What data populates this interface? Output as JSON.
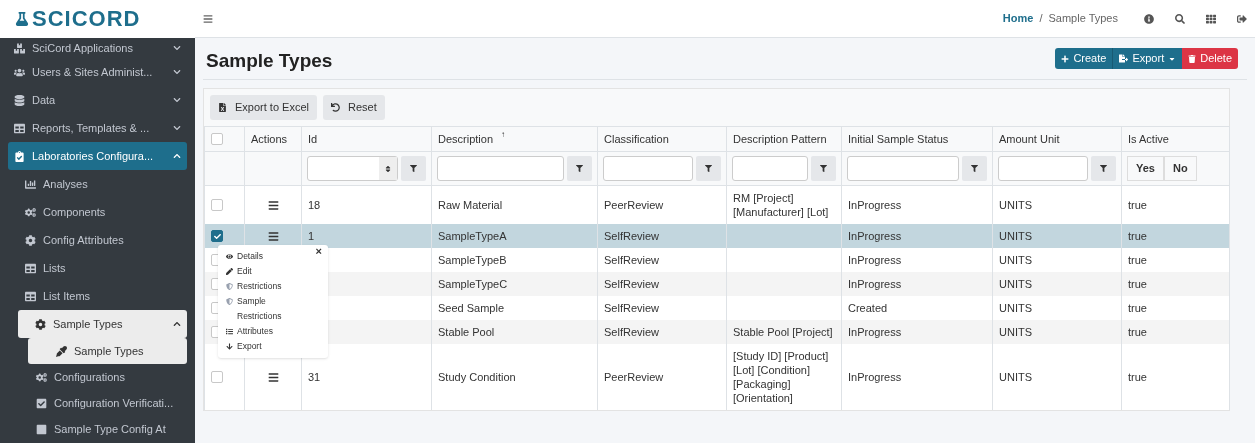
{
  "logo": {
    "text": "SCICORD"
  },
  "header": {
    "breadcrumb": [
      {
        "label": "Home",
        "kind": "link"
      },
      {
        "label": "/",
        "kind": "separator"
      },
      {
        "label": "Sample Types",
        "kind": "current"
      }
    ]
  },
  "sidebar": {
    "items": [
      {
        "label": "SciCord Applications",
        "expanded": false,
        "selected": false
      },
      {
        "label": "Users & Sites Administ...",
        "expanded": false,
        "selected": false
      },
      {
        "label": "Data",
        "expanded": false,
        "selected": false
      },
      {
        "label": "Reports, Templates & ...",
        "expanded": false,
        "selected": false
      },
      {
        "label": "Laboratories Configura...",
        "expanded": true,
        "selected": true,
        "children": [
          {
            "label": "Analyses",
            "selected": false
          },
          {
            "label": "Components",
            "selected": false
          },
          {
            "label": "Config Attributes",
            "selected": false
          },
          {
            "label": "Lists",
            "selected": false
          },
          {
            "label": "List Items",
            "selected": false
          },
          {
            "label": "Sample Types",
            "expanded": true,
            "selected": true,
            "children": [
              {
                "label": "Sample Types",
                "selected": true
              },
              {
                "label": "Configurations",
                "selected": false
              },
              {
                "label": "Configuration Verificati...",
                "selected": false
              },
              {
                "label": "Sample Type Config At",
                "selected": false
              }
            ]
          }
        ]
      }
    ]
  },
  "page": {
    "title": "Sample Types",
    "actions": [
      {
        "label": "Create",
        "kind": "create"
      },
      {
        "label": "Export",
        "kind": "export"
      },
      {
        "label": "Delete",
        "kind": "delete"
      }
    ]
  },
  "toolbar": [
    {
      "label": "Export to Excel",
      "kind": "excel"
    },
    {
      "label": "Reset",
      "kind": "reset"
    }
  ],
  "table": {
    "columns": [
      {
        "kind": "checkbox",
        "checked": false
      },
      {
        "label": "Actions",
        "kind": "none"
      },
      {
        "label": "Id",
        "kind": "number"
      },
      {
        "label": "Description",
        "kind": "text",
        "sort_indicator": "↑"
      },
      {
        "label": "Classification",
        "kind": "text"
      },
      {
        "label": "Description Pattern",
        "kind": "text"
      },
      {
        "label": "Initial Sample Status",
        "kind": "text"
      },
      {
        "label": "Amount Unit",
        "kind": "text"
      },
      {
        "label": "Is Active",
        "kind": "boolean",
        "options": [
          "Yes",
          "No"
        ]
      }
    ],
    "rows": [
      {
        "selected": false,
        "id": "18",
        "description": "Raw Material",
        "classification": "PeerReview",
        "pattern": "RM [Project] [Manufacturer] [Lot]",
        "status": "InProgress",
        "unit": "UNITS",
        "active": "true"
      },
      {
        "selected": true,
        "id": "1",
        "description": "SampleTypeA",
        "classification": "SelfReview",
        "status": "InProgress",
        "unit": "UNITS",
        "active": "true"
      },
      {
        "selected": false,
        "description": "SampleTypeB",
        "classification": "SelfReview",
        "status": "InProgress",
        "unit": "UNITS",
        "active": "true"
      },
      {
        "selected": false,
        "description": "SampleTypeC",
        "classification": "SelfReview",
        "status": "InProgress",
        "unit": "UNITS",
        "active": "true"
      },
      {
        "selected": false,
        "description": "Seed Sample",
        "classification": "SelfReview",
        "status": "Created",
        "unit": "UNITS",
        "active": "true"
      },
      {
        "selected": false,
        "description": "Stable Pool",
        "classification": "SelfReview",
        "pattern": "Stable Pool [Project]",
        "status": "InProgress",
        "unit": "UNITS",
        "active": "true"
      },
      {
        "selected": false,
        "id": "31",
        "description": "Study Condition",
        "classification": "PeerReview",
        "pattern": "[Study ID] [Product] [Lot] [Condition] [Packaging] [Orientation]",
        "status": "InProgress",
        "unit": "UNITS",
        "active": "true"
      }
    ]
  },
  "action_menu": {
    "close": "×",
    "items": [
      {
        "label": "Details",
        "kind": "details"
      },
      {
        "label": "Edit",
        "kind": "edit"
      },
      {
        "label": "Restrictions",
        "kind": "restrictions"
      },
      {
        "label": "Sample Restrictions",
        "kind": "restrictions"
      },
      {
        "label": "Attributes",
        "kind": "attributes"
      },
      {
        "label": "Export",
        "kind": "export"
      }
    ]
  }
}
